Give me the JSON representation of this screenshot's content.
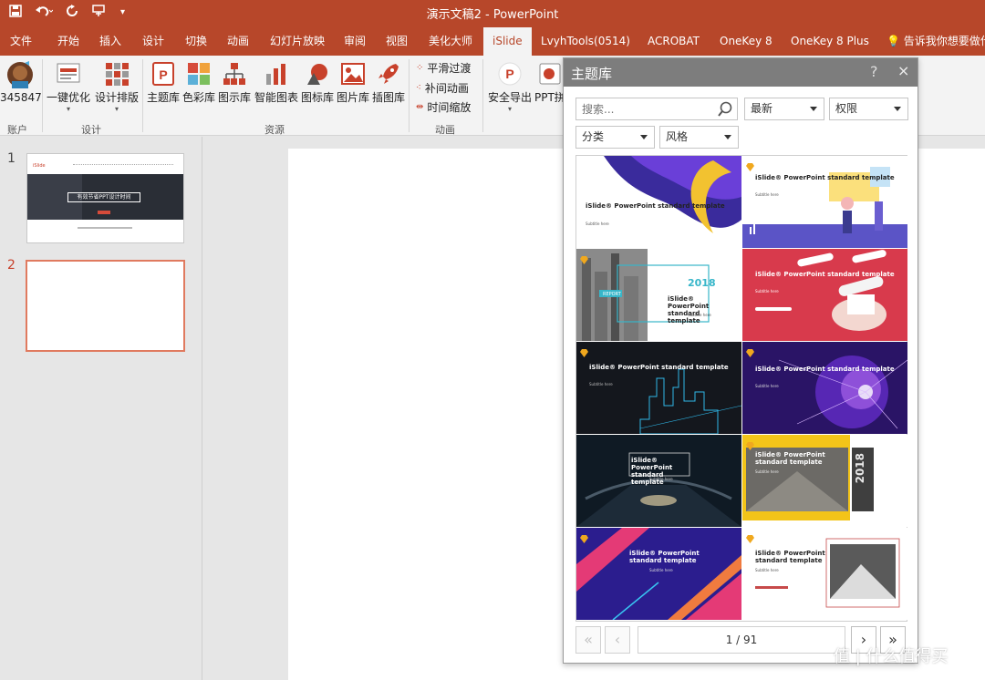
{
  "window": {
    "title": "演示文稿2 - PowerPoint"
  },
  "qat": {
    "save_icon": "save-icon",
    "undo_icon": "undo-icon",
    "redo_icon": "redo-icon",
    "touch_icon": "touch-mode-icon",
    "customize_icon": "customize-icon"
  },
  "tabs": [
    "文件",
    "开始",
    "插入",
    "设计",
    "切换",
    "动画",
    "幻灯片放映",
    "审阅",
    "视图",
    "美化大师",
    "iSlide",
    "LvyhTools(0514)",
    "ACROBAT",
    "OneKey 8",
    "OneKey 8 Plus"
  ],
  "active_tab": "iSlide",
  "tell_me": "告诉我你想要做什",
  "ribbon": {
    "account": {
      "label": "345847",
      "group": "账户"
    },
    "design": {
      "buttons": [
        "一键优化",
        "设计排版"
      ],
      "group": "设计"
    },
    "resources": {
      "buttons": [
        "主题库",
        "色彩库",
        "图示库",
        "智能图表",
        "图标库",
        "图片库",
        "插图库"
      ],
      "group": "资源"
    },
    "animation": {
      "buttons": [
        "平滑过渡",
        "补间动画",
        "时间缩放"
      ],
      "group": "动画"
    },
    "export": {
      "buttons": [
        "安全导出",
        "PPT拼"
      ]
    }
  },
  "slides": {
    "numbers": [
      "1",
      "2"
    ],
    "thumb1": {
      "heading": "有效节省PPT设计时间",
      "logo": "iSlide"
    }
  },
  "dialog": {
    "title": "主题库",
    "help": "?",
    "close": "×",
    "search_placeholder": "搜索...",
    "sort": "最新",
    "permission": "权限",
    "category": "分类",
    "style": "风格",
    "templates": [
      {
        "title": "iSlide® PowerPoint standard template",
        "subtitle": "Subtitle here"
      },
      {
        "title": "iSlide® PowerPoint standard template",
        "subtitle": "Subtitle here"
      },
      {
        "title": "iSlide® PowerPoint standard template",
        "subtitle": "Subtitle here",
        "year": "2018",
        "tag": "REPORT"
      },
      {
        "title": "iSlide® PowerPoint standard template",
        "subtitle": "Subtitle here"
      },
      {
        "title": "iSlide® PowerPoint standard template",
        "subtitle": "Subtitle here"
      },
      {
        "title": "iSlide® PowerPoint standard template",
        "subtitle": "Subtitle here"
      },
      {
        "title": "iSlide® PowerPoint standard template",
        "subtitle": "Subtitle here"
      },
      {
        "title": "iSlide® PowerPoint standard template",
        "subtitle": "Subtitle here",
        "year": "2018"
      },
      {
        "title": "iSlide® PowerPoint standard template",
        "subtitle": "Subtitle here"
      },
      {
        "title": "iSlide® PowerPoint standard template",
        "subtitle": "Subtitle here"
      }
    ],
    "pager": {
      "info": "1 / 91",
      "first": "«",
      "prev": "‹",
      "next": "›",
      "last": "»"
    }
  },
  "watermark": "值 | 什么值得买",
  "colors": {
    "accent": "#b7472a",
    "panel_header": "#7d7d7d"
  }
}
